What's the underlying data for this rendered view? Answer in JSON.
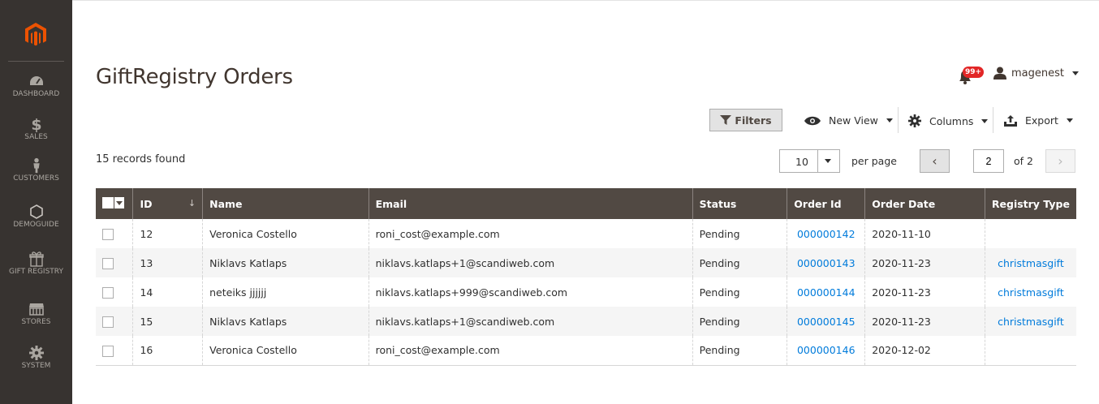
{
  "sidebar": {
    "items": [
      {
        "label": "DASHBOARD",
        "icon": "dashboard-icon"
      },
      {
        "label": "SALES",
        "icon": "dollar-icon"
      },
      {
        "label": "CUSTOMERS",
        "icon": "customer-icon"
      },
      {
        "label": "DEMOGUIDE",
        "icon": "hexagon-icon"
      },
      {
        "label": "GIFT REGISTRY",
        "icon": "gift-icon"
      },
      {
        "label": "STORES",
        "icon": "store-icon"
      },
      {
        "label": "SYSTEM",
        "icon": "gear-icon"
      }
    ]
  },
  "header": {
    "title": "GiftRegistry Orders",
    "notification_count": "99+",
    "user_name": "magenest"
  },
  "toolbar": {
    "filters_label": "Filters",
    "view_label": "New View",
    "columns_label": "Columns",
    "export_label": "Export"
  },
  "pager": {
    "records_found": "15 records found",
    "per_page_value": "10",
    "per_page_label": "per page",
    "current_page": "2",
    "total_pages_label": "of 2"
  },
  "grid": {
    "columns": [
      "ID",
      "Name",
      "Email",
      "Status",
      "Order Id",
      "Order Date",
      "Registry Type"
    ],
    "rows": [
      {
        "id": "12",
        "name": "Veronica Costello",
        "email": "roni_cost@example.com",
        "status": "Pending",
        "order_id": "000000142",
        "order_date": "2020-11-10",
        "registry_type": ""
      },
      {
        "id": "13",
        "name": "Niklavs Katlaps",
        "email": "niklavs.katlaps+1@scandiweb.com",
        "status": "Pending",
        "order_id": "000000143",
        "order_date": "2020-11-23",
        "registry_type": "christmasgift"
      },
      {
        "id": "14",
        "name": "neteiks jjjjjj",
        "email": "niklavs.katlaps+999@scandiweb.com",
        "status": "Pending",
        "order_id": "000000144",
        "order_date": "2020-11-23",
        "registry_type": "christmasgift"
      },
      {
        "id": "15",
        "name": "Niklavs Katlaps",
        "email": "niklavs.katlaps+1@scandiweb.com",
        "status": "Pending",
        "order_id": "000000145",
        "order_date": "2020-11-23",
        "registry_type": "christmasgift"
      },
      {
        "id": "16",
        "name": "Veronica Costello",
        "email": "roni_cost@example.com",
        "status": "Pending",
        "order_id": "000000146",
        "order_date": "2020-12-02",
        "registry_type": ""
      }
    ]
  },
  "colors": {
    "sidebar_bg": "#373330",
    "logo_orange": "#eb5202",
    "header_bg": "#514943",
    "link": "#007bdb",
    "badge": "#e22626"
  }
}
